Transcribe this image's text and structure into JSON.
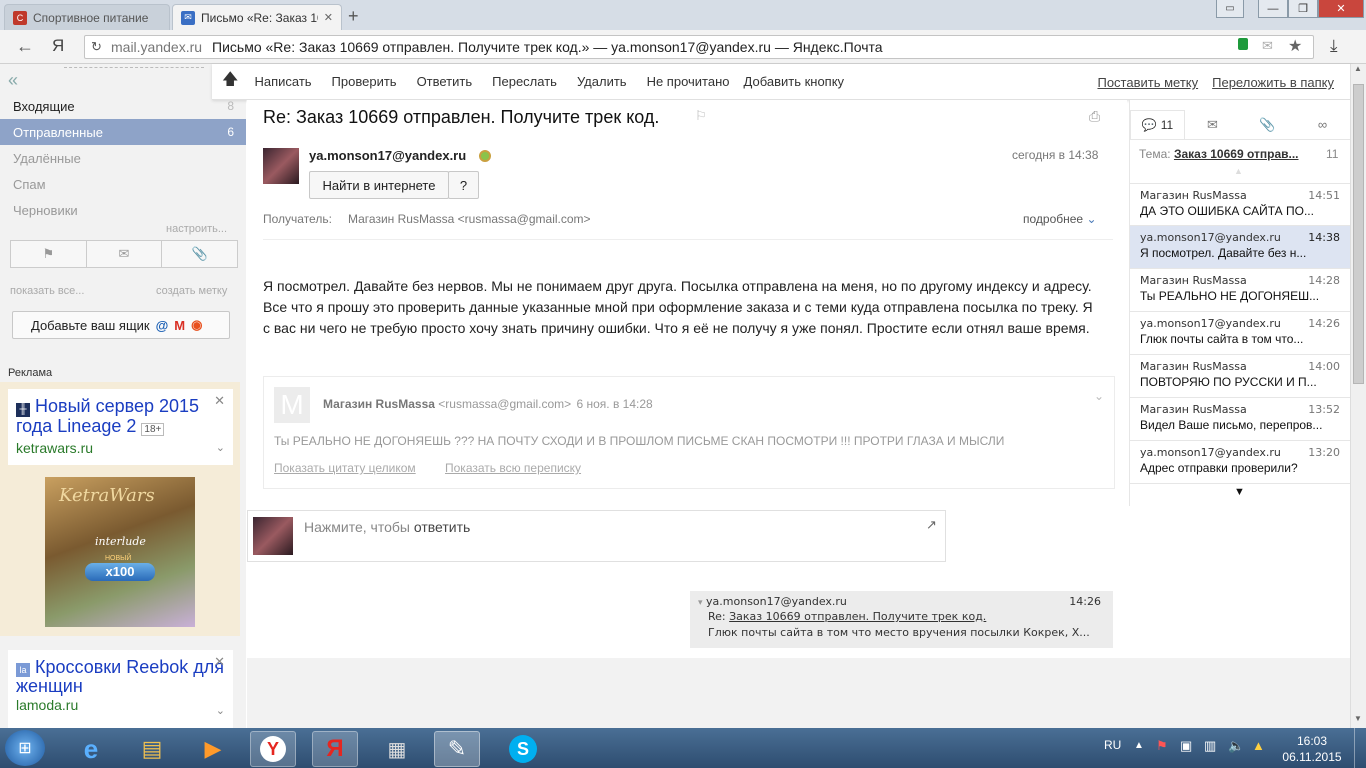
{
  "browser": {
    "tabs": [
      {
        "title": "Спортивное питание",
        "favicon": "С"
      },
      {
        "title": "Письмо «Re: Заказ 10"
      }
    ],
    "url_host": "mail.yandex.ru",
    "url_title": "Письмо «Re: Заказ 10669 отправлен. Получите трек код.» — ya.monson17@yandex.ru — Яндекс.Почта",
    "ya_button": "Я"
  },
  "toolbar": {
    "compose": "Написать",
    "check": "Проверить",
    "reply": "Ответить",
    "forward": "Переслать",
    "delete": "Удалить",
    "unread": "Не прочитано",
    "add_button": "Добавить кнопку",
    "label": "Поставить метку",
    "move": "Переложить в папку"
  },
  "sidebar": {
    "collapse": "«",
    "folders": [
      {
        "name": "Входящие",
        "count": "8"
      },
      {
        "name": "Отправленные",
        "count": "6"
      },
      {
        "name": "Удалённые",
        "count": ""
      },
      {
        "name": "Спам",
        "count": ""
      },
      {
        "name": "Черновики",
        "count": ""
      }
    ],
    "configure": "настроить...",
    "show_all": "показать все...",
    "create_label": "создать метку",
    "add_box": "Добавьте ваш ящик",
    "ads_label": "Реклама",
    "ad1": {
      "title": "Новый сервер 2015 года Lineage 2",
      "age": "18+",
      "domain": "ketrawars.ru",
      "banner_logo": "KetraWars",
      "banner_text": "interlude",
      "banner_badge": "НОВЫЙ",
      "banner_rate": "x100"
    },
    "ad2": {
      "title": "Кроссовки Reebok для женщин",
      "domain": "lamoda.ru",
      "icon": "la"
    }
  },
  "message": {
    "subject": "Re: Заказ 10669 отправлен. Получите трек код.",
    "from": "ya.monson17@yandex.ru",
    "date": "сегодня в 14:38",
    "find_btn": "Найти в интернете",
    "q_btn": "?",
    "recipient_label": "Получатель:",
    "recipient": "Магазин RusMassa <rusmassa@gmail.com>",
    "details": "подробнее",
    "body": "Я посмотрел. Давайте без нервов. Мы не понимаем друг друга. Посылка отправлена на меня, но по другому индексу и адресу. Все что я прошу это проверить данные указанные мной при оформление заказа и с теми куда отправлена посылка по треку. Я с вас ни чего не требую просто хочу знать причину ошибки. Что я её не получу я уже понял. Простите если отнял ваше время.",
    "quote": {
      "avatar": "M",
      "sender": "Магазин RusMassa",
      "email": "<rusmassa@gmail.com>",
      "date": "6 ноя. в 14:28",
      "text": "Ты РЕАЛЬНО НЕ ДОГОНЯЕШЬ ??? НА ПОЧТУ СХОДИ И В ПРОШЛОМ ПИСЬМЕ СКАН ПОСМОТРИ !!! ПРОТРИ ГЛАЗА И МЫСЛИ",
      "show_quote": "Показать цитату целиком",
      "show_thread": "Показать всю переписку"
    },
    "reply_prompt": "Нажмите, чтобы",
    "reply_link": "ответить"
  },
  "tooltip": {
    "from": "ya.monson17@yandex.ru",
    "time": "14:26",
    "re": "Re:",
    "subject": "Заказ 10669 отправлен. Получите трек код.",
    "snippet": "Глюк почты сайта в том что место вручения посылки Кокрек, Х..."
  },
  "thread": {
    "count": "11",
    "subject_label": "Тема:",
    "subject": "Заказ 10669 отправ...",
    "subject_count": "11",
    "items": [
      {
        "from": "Магазин RusMassa",
        "time": "14:51",
        "text": "ДА ЭТО ОШИБКА САЙТА ПО..."
      },
      {
        "from": "ya.monson17@yandex.ru",
        "time": "14:38",
        "text": "Я посмотрел. Давайте без н..."
      },
      {
        "from": "Магазин RusMassa",
        "time": "14:28",
        "text": "Ты РЕАЛЬНО НЕ ДОГОНЯЕШ..."
      },
      {
        "from": "ya.monson17@yandex.ru",
        "time": "14:26",
        "text": "Глюк почты сайта в том что..."
      },
      {
        "from": "Магазин RusMassa",
        "time": "14:00",
        "text": "ПОВТОРЯЮ ПО РУССКИ И П..."
      },
      {
        "from": "Магазин RusMassa",
        "time": "13:52",
        "text": "Видел Ваше письмо, перепров..."
      },
      {
        "from": "ya.monson17@yandex.ru",
        "time": "13:20",
        "text": "Адрес отправки проверили?"
      }
    ]
  },
  "taskbar": {
    "lang": "RU",
    "time": "16:03",
    "date": "06.11.2015",
    "yandex": "Я"
  },
  "colors": {
    "selected_folder": "#8ea3c8",
    "thread_selected": "#dde4f2",
    "link": "#1a3dc1"
  }
}
